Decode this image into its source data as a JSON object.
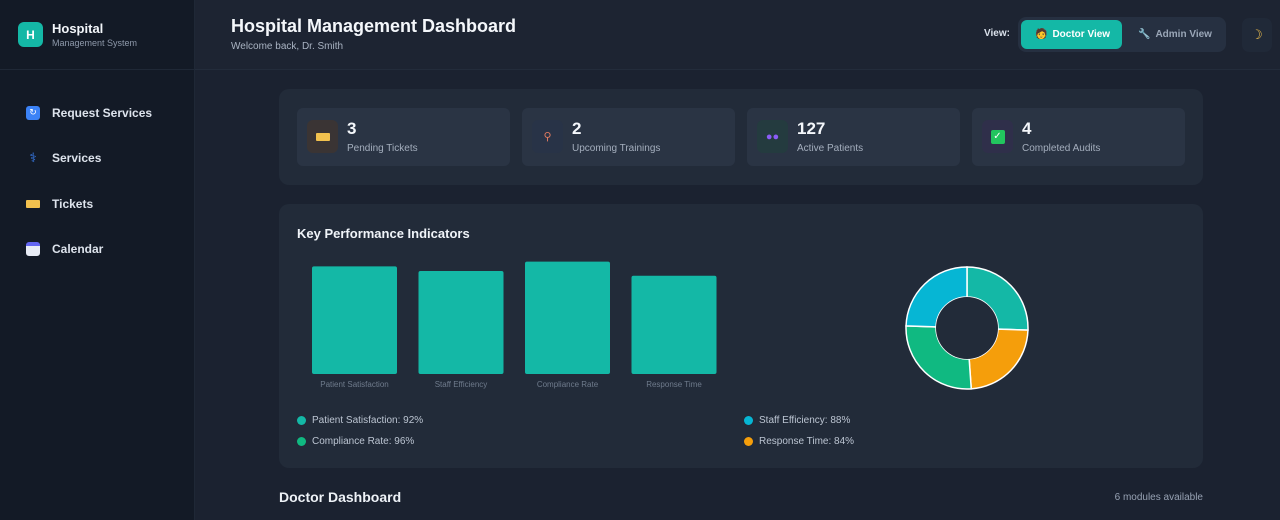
{
  "brand": {
    "logo_letter": "H",
    "title": "Hospital",
    "subtitle": "Management System"
  },
  "sidebar": {
    "items": [
      {
        "label": "Request Services",
        "icon": "refresh-icon"
      },
      {
        "label": "Services",
        "icon": "caduceus-icon"
      },
      {
        "label": "Tickets",
        "icon": "ticket-icon"
      },
      {
        "label": "Calendar",
        "icon": "calendar-icon"
      }
    ]
  },
  "header": {
    "title": "Hospital Management Dashboard",
    "subtitle": "Welcome back, Dr. Smith",
    "view_label": "View:",
    "views": [
      {
        "label": "Doctor View",
        "icon": "doctor-icon",
        "active": true
      },
      {
        "label": "Admin View",
        "icon": "wrench-icon",
        "active": false
      }
    ],
    "theme_icon": "moon-icon"
  },
  "stats": [
    {
      "value": "3",
      "label": "Pending Tickets",
      "icon": "ticket-icon",
      "color": "#f2c14e"
    },
    {
      "value": "2",
      "label": "Upcoming Trainings",
      "icon": "graduation-icon",
      "color": "#e07a5f"
    },
    {
      "value": "127",
      "label": "Active Patients",
      "icon": "users-icon",
      "color": "#8b5cf6"
    },
    {
      "value": "4",
      "label": "Completed Audits",
      "icon": "check-icon",
      "color": "#22c55e"
    }
  ],
  "kpi": {
    "title": "Key Performance Indicators",
    "legend": [
      {
        "text": "Patient Satisfaction: 92%",
        "color": "#14b8a6"
      },
      {
        "text": "Staff Efficiency: 88%",
        "color": "#06b6d4"
      },
      {
        "text": "Compliance Rate: 96%",
        "color": "#10b981"
      },
      {
        "text": "Response Time: 84%",
        "color": "#f59e0b"
      }
    ]
  },
  "chart_data": [
    {
      "type": "bar",
      "categories": [
        "Patient Satisfaction",
        "Staff Efficiency",
        "Compliance Rate",
        "Response Time"
      ],
      "values": [
        92,
        88,
        96,
        84
      ],
      "color": "#14b8a6",
      "ylim": [
        0,
        100
      ]
    },
    {
      "type": "pie",
      "categories": [
        "Patient Satisfaction",
        "Response Time",
        "Compliance Rate",
        "Staff Efficiency"
      ],
      "values": [
        92,
        84,
        96,
        88
      ],
      "colors": [
        "#14b8a6",
        "#f59e0b",
        "#10b981",
        "#06b6d4"
      ]
    }
  ],
  "section": {
    "title": "Doctor Dashboard",
    "meta": "6 modules available"
  }
}
